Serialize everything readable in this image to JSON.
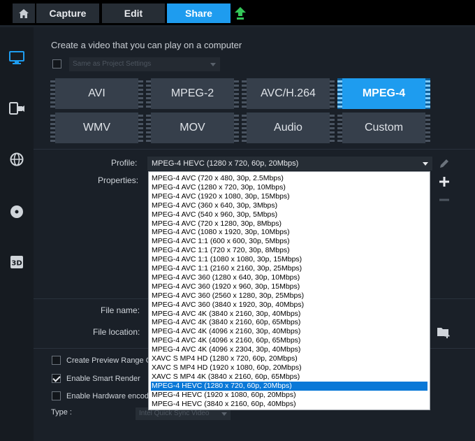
{
  "topbar": {
    "home_icon": "home-icon",
    "tabs": [
      {
        "label": "Capture"
      },
      {
        "label": "Edit"
      },
      {
        "label": "Share",
        "active": true
      }
    ],
    "upload_icon": "upload-arrow-icon",
    "accent": "#1e9cef",
    "upload_color": "#34c759"
  },
  "sidebar": {
    "items": [
      {
        "icon": "monitor-icon",
        "active": true
      },
      {
        "icon": "device-icon"
      },
      {
        "icon": "globe-icon"
      },
      {
        "icon": "disc-icon"
      },
      {
        "icon": "3d-icon",
        "label": "3D"
      }
    ]
  },
  "main": {
    "headline": "Create a video that you can play on a computer",
    "same_as_project": {
      "checked": false,
      "label": "Same as Project Settings"
    },
    "formats": [
      {
        "label": "AVI"
      },
      {
        "label": "MPEG-2"
      },
      {
        "label": "AVC/H.264"
      },
      {
        "label": "MPEG-4",
        "selected": true
      },
      {
        "label": "WMV"
      },
      {
        "label": "MOV"
      },
      {
        "label": "Audio"
      },
      {
        "label": "Custom"
      }
    ],
    "profile_label": "Profile:",
    "profile_value": "MPEG-4 HEVC (1280 x 720, 60p, 20Mbps)",
    "properties_label": "Properties:",
    "file_name_label": "File name:",
    "file_location_label": "File location:",
    "options": {
      "preview_range": {
        "label": "Create Preview Range Onl",
        "checked": false
      },
      "smart_render": {
        "label": "Enable Smart Render",
        "checked": true
      },
      "hardware_encode": {
        "label": "Enable Hardware encode",
        "checked": false
      }
    },
    "type_label": "Type :",
    "type_value": "Intel Quick Sync Video"
  },
  "dropdown": {
    "items": [
      "MPEG-4 AVC (720 x 480, 30p, 2.5Mbps)",
      "MPEG-4 AVC (1280 x 720, 30p, 10Mbps)",
      "MPEG-4 AVC (1920 x 1080, 30p, 15Mbps)",
      "MPEG-4 AVC (360 x 640, 30p, 3Mbps)",
      "MPEG-4 AVC (540 x 960, 30p, 5Mbps)",
      "MPEG-4 AVC (720 x 1280, 30p, 8Mbps)",
      "MPEG-4 AVC (1080 x 1920, 30p, 10Mbps)",
      "MPEG-4 AVC 1:1 (600 x 600, 30p, 5Mbps)",
      "MPEG-4 AVC 1:1 (720 x 720, 30p, 8Mbps)",
      "MPEG-4 AVC 1:1 (1080 x 1080, 30p, 15Mbps)",
      "MPEG-4 AVC 1:1 (2160 x 2160, 30p, 25Mbps)",
      "MPEG-4 AVC 360 (1280 x 640, 30p, 10Mbps)",
      "MPEG-4 AVC 360 (1920 x 960, 30p, 15Mbps)",
      "MPEG-4 AVC 360 (2560 x 1280, 30p, 25Mbps)",
      "MPEG-4 AVC 360 (3840 x 1920, 30p, 40Mbps)",
      "MPEG-4 AVC 4K (3840 x 2160, 30p, 40Mbps)",
      "MPEG-4 AVC 4K (3840 x 2160, 60p, 65Mbps)",
      "MPEG-4 AVC 4K (4096 x 2160, 30p, 40Mbps)",
      "MPEG-4 AVC 4K (4096 x 2160, 60p, 65Mbps)",
      "MPEG-4 AVC 4K (4096 x 2304, 30p, 40Mbps)",
      "XAVC S MP4 HD (1280 x 720, 60p, 20Mbps)",
      "XAVC S MP4 HD (1920 x 1080, 60p, 20Mbps)",
      "XAVC S MP4 4K (3840 x 2160, 60p, 65Mbps)",
      "MPEG-4 HEVC (1280 x 720, 60p, 20Mbps)",
      "MPEG-4 HEVC (1920 x 1080, 60p, 20Mbps)",
      "MPEG-4 HEVC (3840 x 2160, 60p, 40Mbps)"
    ],
    "selected_index": 23
  },
  "tools": [
    "edit-pencil-icon",
    "add-icon",
    "remove-icon",
    "folder-add-icon"
  ]
}
